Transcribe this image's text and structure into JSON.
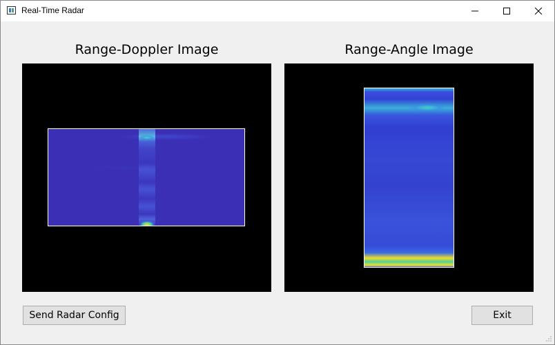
{
  "window": {
    "title": "Real-Time Radar",
    "controls": [
      "minimize",
      "maximize",
      "close"
    ]
  },
  "range_doppler": {
    "title": "Range-Doppler Image"
  },
  "range_angle": {
    "title": "Range-Angle Image"
  },
  "buttons": {
    "send_config": "Send Radar Config",
    "exit": "Exit"
  },
  "colors": {
    "plot_background": "#000000",
    "heatmap_low": "#3b2fb5",
    "heatmap_mid": "#3fd6c0",
    "heatmap_high": "#f5e12a"
  }
}
